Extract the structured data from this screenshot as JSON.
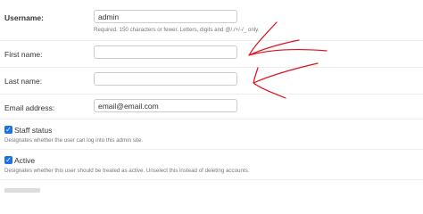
{
  "form": {
    "username": {
      "label": "Username:",
      "value": "admin",
      "help": "Required. 150 characters or fewer. Letters, digits and @/./+/-/_ only."
    },
    "first_name": {
      "label": "First name:",
      "value": ""
    },
    "last_name": {
      "label": "Last name:",
      "value": ""
    },
    "email": {
      "label": "Email address:",
      "value": "email@email.com"
    },
    "staff_status": {
      "label": "Staff status",
      "checked": true,
      "help": "Designates whether the user can log into this admin site."
    },
    "active": {
      "label": "Active",
      "checked": true,
      "help": "Designates whether this user should be treated as active. Unselect this instead of deleting accounts."
    }
  },
  "colors": {
    "annotation": "#e0101e",
    "checkbox": "#1a73e8"
  }
}
